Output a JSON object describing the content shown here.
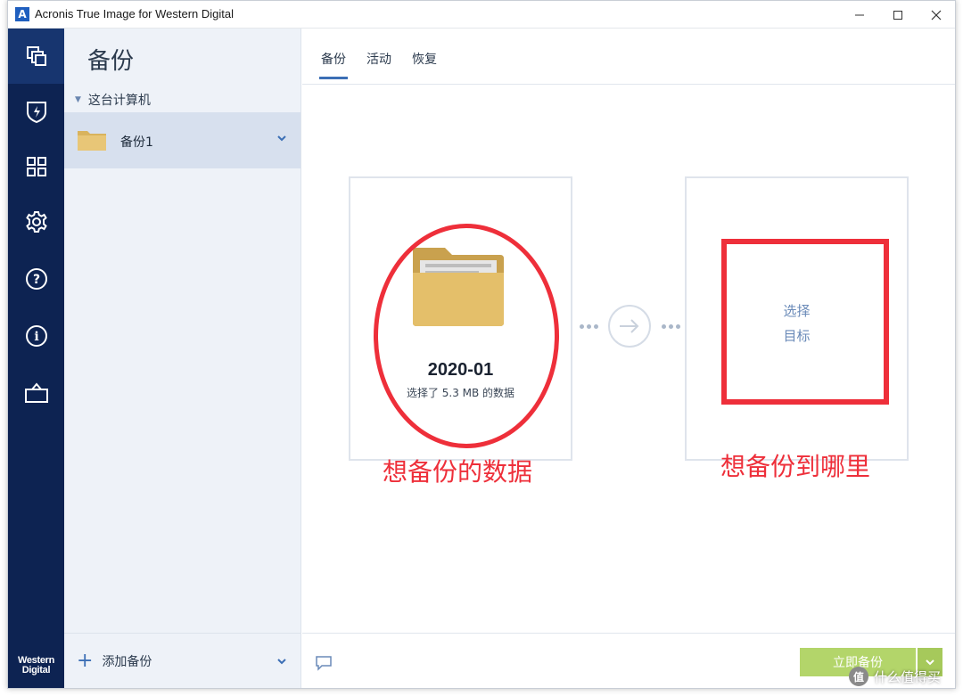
{
  "window": {
    "title": "Acronis True Image for Western Digital",
    "logo_letter": "A"
  },
  "rail": {
    "items": [
      {
        "icon": "backup-icon"
      },
      {
        "icon": "shield-icon"
      },
      {
        "icon": "dashboard-icon"
      },
      {
        "icon": "gear-icon"
      },
      {
        "icon": "help-icon"
      },
      {
        "icon": "info-icon"
      },
      {
        "icon": "briefcase-icon"
      }
    ],
    "brand_line1": "Western",
    "brand_line2": "Digital"
  },
  "backup_list": {
    "title": "备份",
    "group_label": "这台计算机",
    "items": [
      {
        "label": "备份1"
      }
    ],
    "add_label": "添加备份"
  },
  "tabs": [
    {
      "label": "备份",
      "active": true
    },
    {
      "label": "活动",
      "active": false
    },
    {
      "label": "恢复",
      "active": false
    }
  ],
  "source": {
    "name": "2020-01",
    "size_text": "选择了 5.3 MB 的数据"
  },
  "destination": {
    "line1": "选择",
    "line2": "目标"
  },
  "annotations": {
    "source_note": "想备份的数据",
    "dest_note": "想备份到哪里",
    "color": "#ee2f3a"
  },
  "footer": {
    "backup_now_label": "立即备份"
  },
  "watermark": {
    "badge": "值",
    "text": "什么值得买"
  },
  "colors": {
    "rail": "#0d2352",
    "accent": "#3c6fb5",
    "folder": "#e4bf6a",
    "backup_button": "#b3d56a"
  }
}
